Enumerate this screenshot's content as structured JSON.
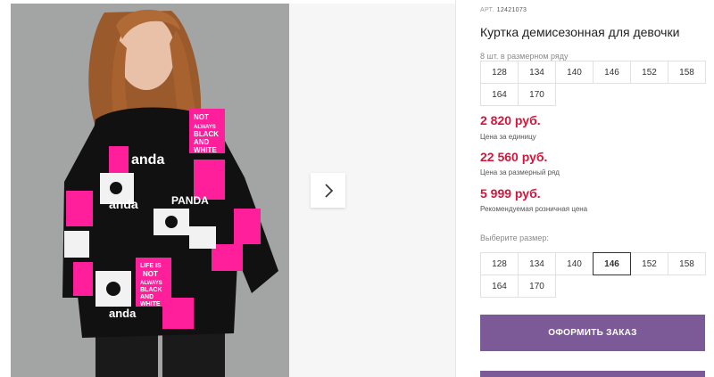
{
  "gallery": {
    "image_alt": "Girl wearing pink and black panda print jacket",
    "jacket_print_text": [
      "NOT",
      "ALWAYS",
      "BLACK",
      "AND",
      "WHITE",
      "LIFE IS",
      "PANDA",
      "anda"
    ],
    "next_icon": "chevron-right-icon"
  },
  "product": {
    "art_label": "АРТ.",
    "art_value": "12421073",
    "title": "Куртка демисезонная для девочки"
  },
  "size_row": {
    "label": "8 шт. в размерном ряду",
    "sizes": [
      "128",
      "134",
      "140",
      "146",
      "152",
      "158",
      "164",
      "170"
    ]
  },
  "prices": {
    "unit_price": "2 820 руб.",
    "unit_label": "Цена за единицу",
    "row_price": "22 560 руб.",
    "row_label": "Цена за размерный ряд",
    "retail_price": "5 999 руб.",
    "retail_label": "Рекомендуемая розничная цена"
  },
  "size_select": {
    "label": "Выберите размер:",
    "sizes": [
      "128",
      "134",
      "140",
      "146",
      "152",
      "158",
      "164",
      "170"
    ],
    "selected": "146"
  },
  "actions": {
    "order_label": "ОФОРМИТЬ ЗАКАЗ"
  },
  "colors": {
    "price": "#d0183c",
    "button": "#7c5a97",
    "jacket_pink": "#ff1f9a"
  }
}
